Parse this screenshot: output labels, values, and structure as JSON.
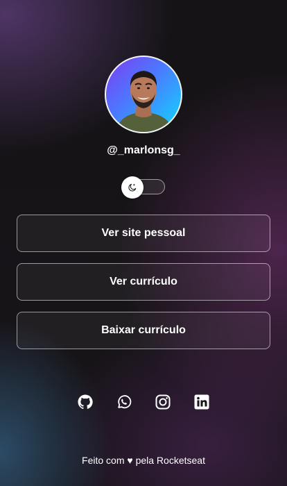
{
  "profile": {
    "username": "@_marlonsg_"
  },
  "theme_toggle": {
    "icon": "moon-icon"
  },
  "links": [
    {
      "label": "Ver site pessoal"
    },
    {
      "label": "Ver currículo"
    },
    {
      "label": "Baixar currículo"
    }
  ],
  "social": [
    {
      "icon": "github-icon"
    },
    {
      "icon": "whatsapp-icon"
    },
    {
      "icon": "instagram-icon"
    },
    {
      "icon": "linkedin-icon"
    }
  ],
  "footer": {
    "text": "Feito com ♥ pela Rocketseat"
  },
  "colors": {
    "background": "#17141a",
    "text": "#ffffff",
    "button_border": "#ffffff",
    "avatar_gradient_start": "#7d3cf2",
    "avatar_gradient_end": "#0fd8ff"
  }
}
